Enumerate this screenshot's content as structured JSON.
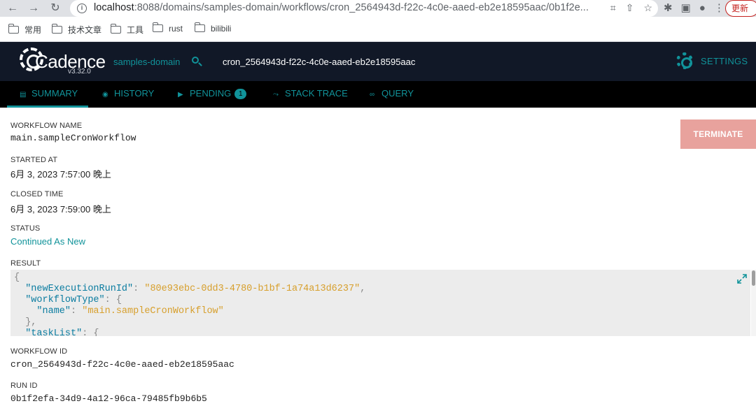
{
  "browser": {
    "url_host": "localhost",
    "url_rest": ":8088/domains/samples-domain/workflows/cron_2564943d-f22c-4c0e-aaed-eb2e18595aac/0b1f2e...",
    "update_label": "更新",
    "bookmarks": [
      "常用",
      "技术文章",
      "工具",
      "rust",
      "bilibili"
    ]
  },
  "header": {
    "logo_text": "Cadence",
    "version": "v3.32.0",
    "domain": "samples-domain",
    "workflow": "cron_2564943d-f22c-4c0e-aaed-eb2e18595aac",
    "settings_label": "SETTINGS"
  },
  "tabs": {
    "summary": "SUMMARY",
    "history": "HISTORY",
    "pending": "PENDING",
    "pending_count": "1",
    "stack_trace": "STACK TRACE",
    "query": "QUERY"
  },
  "summary": {
    "workflow_name_label": "WORKFLOW NAME",
    "workflow_name": "main.sampleCronWorkflow",
    "started_at_label": "STARTED AT",
    "started_at": "6月 3, 2023 7:57:00 晚上",
    "closed_time_label": "CLOSED TIME",
    "closed_time": "6月 3, 2023 7:59:00 晚上",
    "status_label": "STATUS",
    "status": "Continued As New",
    "result_label": "RESULT",
    "workflow_id_label": "WORKFLOW ID",
    "workflow_id": "cron_2564943d-f22c-4c0e-aaed-eb2e18595aac",
    "run_id_label": "RUN ID",
    "run_id": "0b1f2efa-34d9-4a12-96ca-79485fb9b6b5",
    "terminate_label": "TERMINATE"
  },
  "result_json": {
    "open_brace": "{",
    "key1": "\"newExecutionRunId\"",
    "val1": "\"80e93ebc-0dd3-4780-b1bf-1a74a13d6237\"",
    "key2": "\"workflowType\"",
    "key3": "\"name\"",
    "val3": "\"main.sampleCronWorkflow\"",
    "close_obj": "},",
    "key4": "\"taskList\"",
    "colon": ": ",
    "comma": ",",
    "open_obj": "{"
  },
  "colors": {
    "accent": "#11939a",
    "header_bg": "#111827",
    "tab_bg": "#000000",
    "terminate_bg": "#e8a29d",
    "json_key": "#0a7ca0",
    "json_string": "#d79f2c"
  }
}
